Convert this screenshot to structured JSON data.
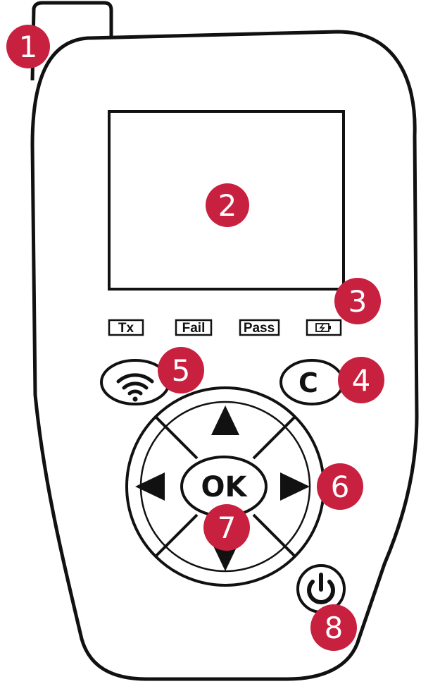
{
  "indicators": {
    "tx": "Tx",
    "fail": "Fail",
    "pass": "Pass"
  },
  "buttons": {
    "ok": "OK",
    "clear": "C"
  },
  "callouts": [
    "1",
    "2",
    "3",
    "4",
    "5",
    "6",
    "7",
    "8"
  ],
  "colors": {
    "callout": "#c8203f",
    "outline": "#111111",
    "body": "#ffffff"
  },
  "icons": {
    "antenna": "antenna-icon",
    "wifi": "wifi-icon",
    "battery": "battery-charging-icon",
    "power": "power-icon",
    "arrows": [
      "arrow-up-icon",
      "arrow-down-icon",
      "arrow-left-icon",
      "arrow-right-icon"
    ]
  }
}
